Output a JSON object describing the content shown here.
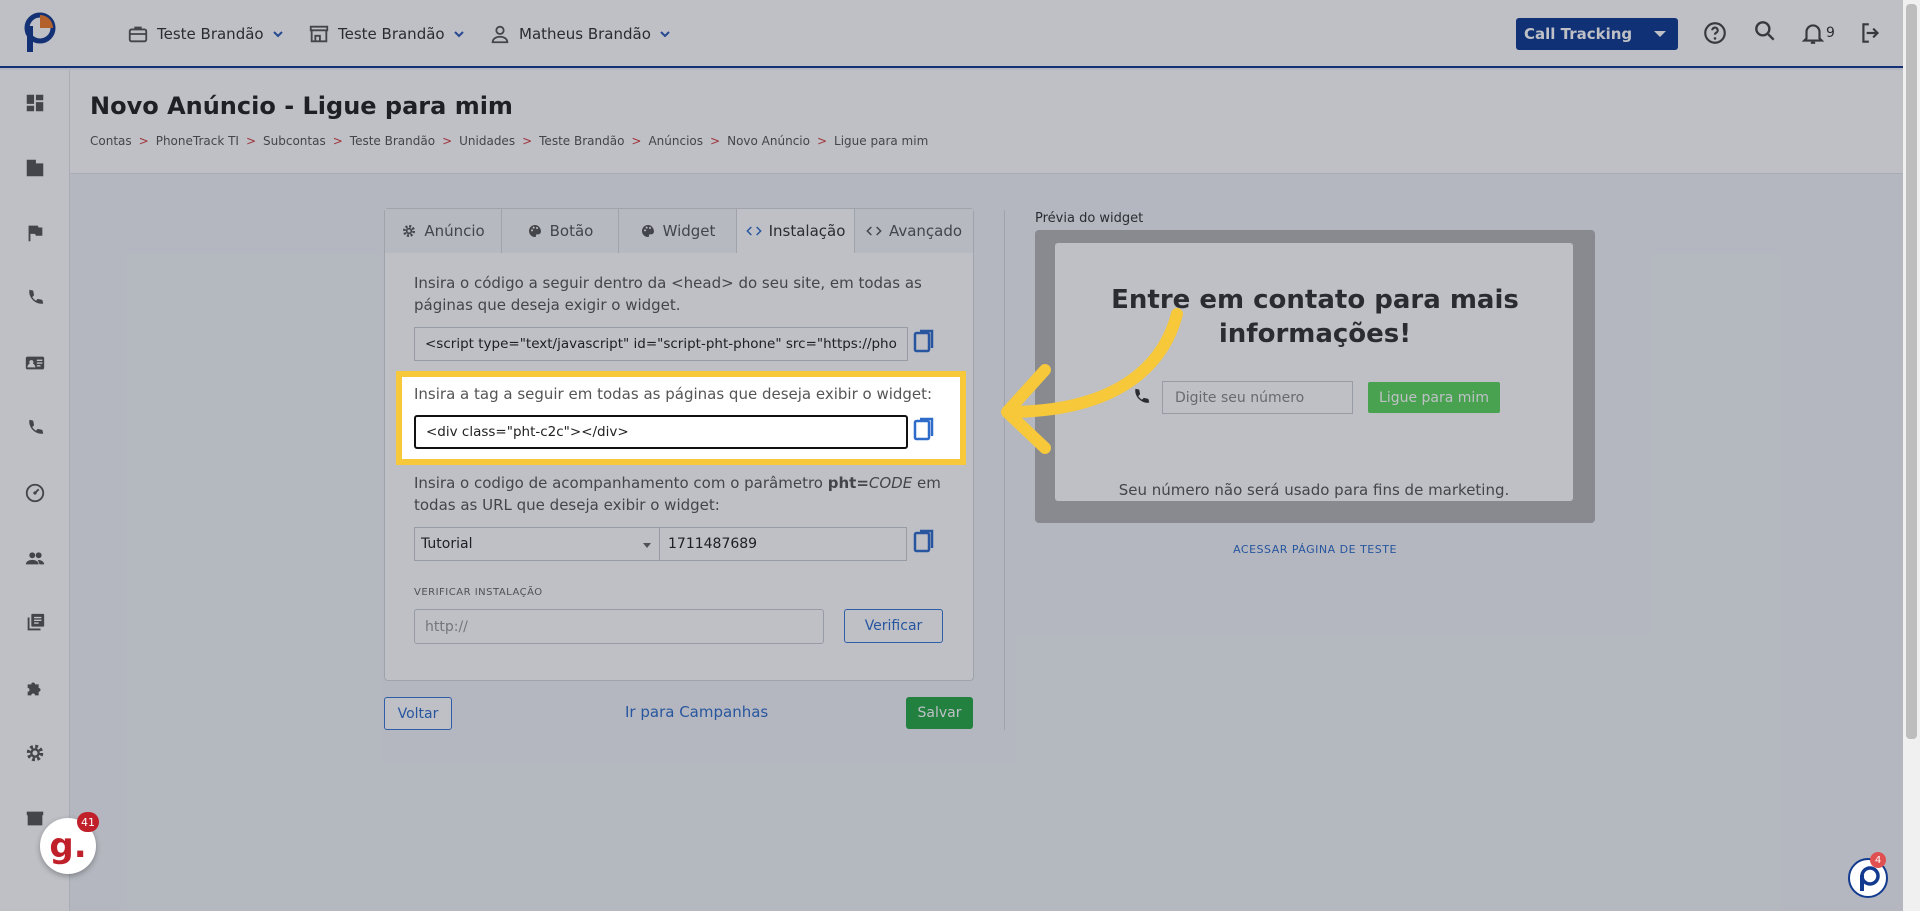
{
  "topbar": {
    "account_label": "Teste Brandão",
    "unit_label": "Teste Brandão",
    "user_label": "Matheus Brandão",
    "product_select": "Call Tracking",
    "notifications_count": "9"
  },
  "page": {
    "title": "Novo Anúncio - Ligue para mim",
    "breadcrumb": [
      "Contas",
      "PhoneTrack TI",
      "Subcontas",
      "Teste Brandão",
      "Unidades",
      "Teste Brandão",
      "Anúncios",
      "Novo Anúncio",
      "Ligue para mim"
    ],
    "breadcrumb_sep": ">"
  },
  "tabs": [
    {
      "label": "Anúncio",
      "icon": "gear-icon"
    },
    {
      "label": "Botão",
      "icon": "palette-icon"
    },
    {
      "label": "Widget",
      "icon": "palette-icon"
    },
    {
      "label": "Instalação",
      "icon": "code-icon",
      "active": true
    },
    {
      "label": "Avançado",
      "icon": "code-icon"
    }
  ],
  "install": {
    "head_instruction": "Insira o código a seguir dentro da <head> do seu site, em todas as páginas que deseja exigir o widget.",
    "head_code": "<script type=\"text/javascript\" id=\"script-pht-phone\" src=\"https://pho",
    "tag_instruction": "Insira a tag a seguir em todas as páginas que deseja exibir o widget:",
    "tag_code": "<div class=\"pht-c2c\"></div>",
    "tracking_instruction_pre": "Insira o codigo de acompanhamento com o parâmetro ",
    "tracking_param": "pht=",
    "tracking_code_word": "CODE",
    "tracking_instruction_post": " em todas as URL que deseja exibir o widget:",
    "source_select": "Tutorial",
    "tracking_code": "1711487689",
    "verify_label": "VERIFICAR INSTALAÇÃO",
    "url_placeholder": "http://",
    "verify_button": "Verificar"
  },
  "actions": {
    "back": "Voltar",
    "campaigns_link": "Ir para Campanhas",
    "save": "Salvar"
  },
  "preview": {
    "label": "Prévia do widget",
    "title": "Entre em contato para mais informações!",
    "input_placeholder": "Digite seu número",
    "button": "Ligue para mim",
    "note": "Seu número não será usado para fins de marketing.",
    "test_link": "ACESSAR PÁGINA DE TESTE"
  },
  "badges": {
    "g_count": "41",
    "chat_count": "4"
  },
  "colors": {
    "brand_blue": "#0f3a8f",
    "highlight_yellow": "#f6c83a",
    "save_green": "#27a845",
    "preview_green": "#5cd65c"
  }
}
